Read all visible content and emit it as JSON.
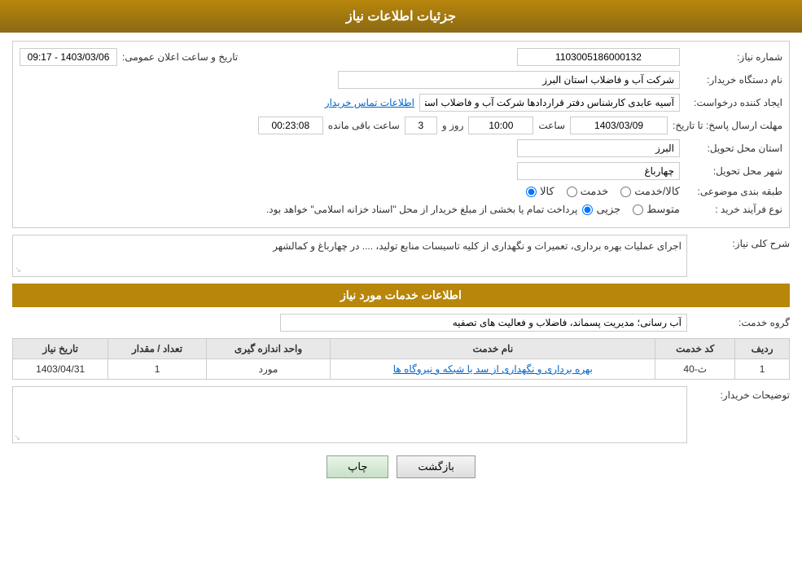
{
  "header": {
    "title": "جزئیات اطلاعات نیاز"
  },
  "fields": {
    "shomara_niaz_label": "شماره نیاز:",
    "shomara_niaz_value": "1103005186000132",
    "tarikh_label": "تاریخ و ساعت اعلان عمومی:",
    "tarikh_value": "1403/03/06 - 09:17",
    "nam_dastgah_label": "نام دستگاه خریدار:",
    "nam_dastgah_value": "شرکت آب و فاضلاب استان البرز",
    "ijad_konande_label": "ایجاد کننده درخواست:",
    "ijad_konande_value": "آسیه عابدی کارشناس دفتر قراردادها شرکت آب و فاضلاب استان البرز",
    "contact_link": "اطلاعات تماس خریدار",
    "mohlat_label": "مهلت ارسال پاسخ: تا تاریخ:",
    "mohlat_date": "1403/03/09",
    "mohlat_saat_label": "ساعت",
    "mohlat_saat": "10:00",
    "mohlat_rooz_label": "روز و",
    "mohlat_rooz": "3",
    "mohlat_baqi_label": "ساعت باقی مانده",
    "mohlat_baqi": "00:23:08",
    "ostan_label": "استان محل تحویل:",
    "ostan_value": "البرز",
    "shahr_label": "شهر محل تحویل:",
    "shahr_value": "چهارباغ",
    "tabaghebandi_label": "طبقه بندی موضوعی:",
    "tabaghebandi_options": [
      "کالا",
      "خدمت",
      "کالا/خدمت"
    ],
    "tabaghebandi_selected": "کالا",
    "noe_farayand_label": "نوع فرآیند خرید :",
    "noe_farayand_options": [
      "جزیی",
      "متوسط"
    ],
    "noe_farayand_text": "پرداخت تمام یا بخشی از مبلغ خریدار از محل \"اسناد خزانه اسلامی\" خواهد بود.",
    "sharh_label": "شرح کلی نیاز:",
    "sharh_value": "اجرای عملیات بهره برداری، تعمیرات و نگهداری از کلیه تاسیسات منابع تولید، .... در چهارباغ و کمالشهر",
    "khadamat_label": "اطلاعات خدمات مورد نیاز",
    "gorooh_label": "گروه خدمت:",
    "gorooh_value": "آب رسانی؛ مدیریت پسماند، فاضلاب و فعالیت های تصفیه",
    "table": {
      "headers": [
        "ردیف",
        "کد خدمت",
        "نام خدمت",
        "واحد اندازه گیری",
        "تعداد / مقدار",
        "تاریخ نیاز"
      ],
      "rows": [
        {
          "radif": "1",
          "kod": "ث-40",
          "name": "بهره برداری و نگهداری از سد یا شبکه و نیروگاه ها",
          "vahed": "مورد",
          "tedad": "1",
          "tarikh": "1403/04/31"
        }
      ]
    },
    "tosihihat_label": "توضیحات خریدار:",
    "back_btn": "بازگشت",
    "print_btn": "چاپ"
  }
}
